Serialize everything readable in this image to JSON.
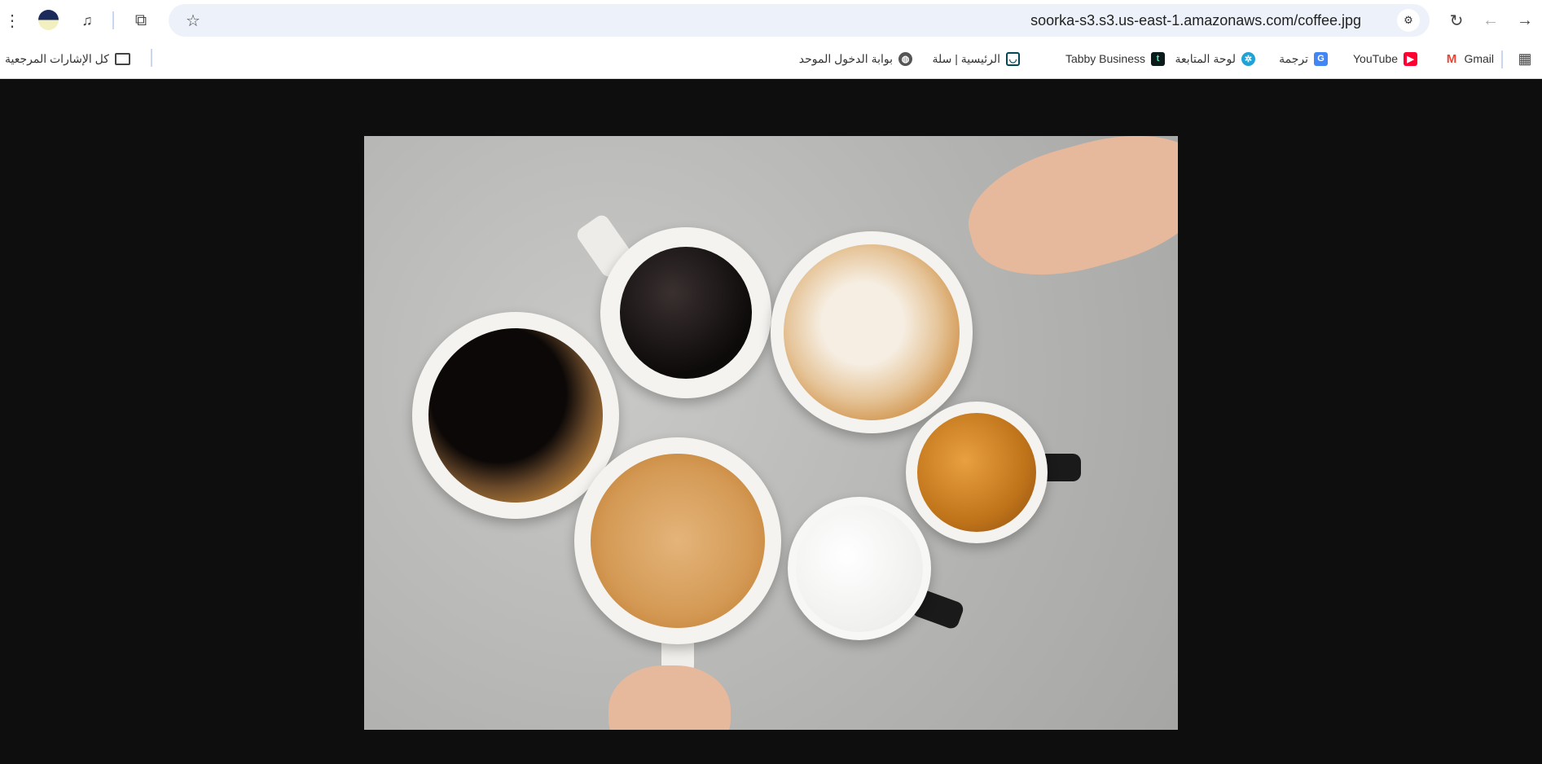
{
  "browser": {
    "url": "soorka-s3.s3.us-east-1.amazonaws.com/coffee.jpg",
    "icons": [
      "menu-icon",
      "avatar",
      "media-icon",
      "extensions-icon",
      "star-icon",
      "tune-icon",
      "reload-icon",
      "back-icon",
      "forward-icon",
      "apps-icon"
    ]
  },
  "bookmarks": {
    "items": [
      {
        "label": "Gmail",
        "color": "#ea4335"
      },
      {
        "label": "YouTube",
        "color": "#ff0000"
      },
      {
        "label": "ترجمة",
        "color": "#4285f4"
      },
      {
        "label": "لوحة المتابعة",
        "color": "#1fa2d6"
      },
      {
        "label": "Tabby Business",
        "color": "#0b1a1a"
      },
      {
        "label": "الرئيسية | سلة",
        "color": "#004956"
      },
      {
        "label": "بوابة الدخول الموحد",
        "color": "#555555"
      }
    ],
    "all_bookmarks": "كل الإشارات المرجعية"
  }
}
